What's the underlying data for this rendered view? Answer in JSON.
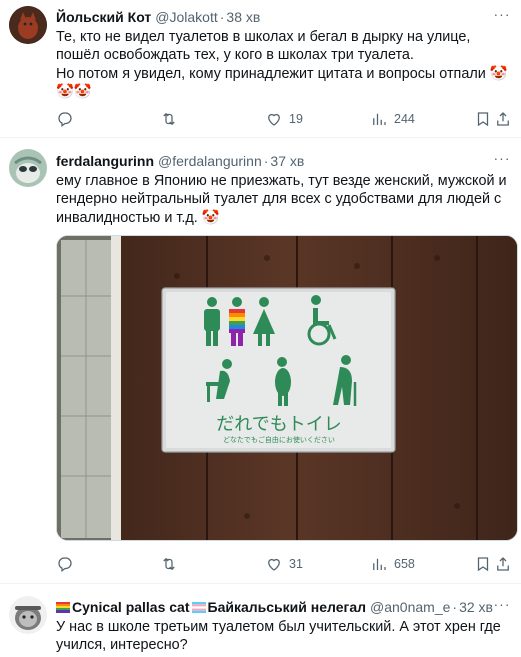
{
  "tweets": [
    {
      "name": "Йольский Кот",
      "handle": "@Jolakott",
      "sep": "·",
      "time": "38 хв",
      "text": "Те, кто не видел туалетов в школах и бегал в дырку на улице, пошёл освобождать тех, у кого в школах три туалета.\nНо потом я увидел, кому принадлежит цитата и вопросы отпали 🤡🤡🤡",
      "replies": "",
      "retweets": "",
      "likes": "19",
      "views": "244"
    },
    {
      "name": "ferdalangurinn",
      "handle": "@ferdalangurinn",
      "sep": "·",
      "time": "37 хв",
      "text": "ему главное в Японию не приезжать, тут везде женский, мужской и гендерно нейтральный туалет для всех с удобствами для людей с инвалидностью и т.д. 🤡",
      "replies": "",
      "retweets": "",
      "likes": "31",
      "views": "658",
      "photo": {
        "sign_title": "だれでもトイレ",
        "sign_subtitle": "どなたでもご自由にお使いください"
      }
    },
    {
      "name_prefix": "Cynical pallas cat",
      "name_suffix": "Байкальський нелегал",
      "handle": "@an0nam_e",
      "sep": "·",
      "time": "32 хв",
      "text": "У нас в школе третьим туалетом был учительский. А этот хрен где учился, интересно?"
    }
  ],
  "more_label": "···",
  "colors": {
    "text": "#0f1419",
    "secondary": "#536471",
    "divider": "#eff3f4",
    "sign_green": "#2e8b57"
  },
  "icons": [
    "reply-icon",
    "retweet-icon",
    "like-icon",
    "views-icon",
    "bookmark-icon",
    "share-icon",
    "more-icon"
  ]
}
